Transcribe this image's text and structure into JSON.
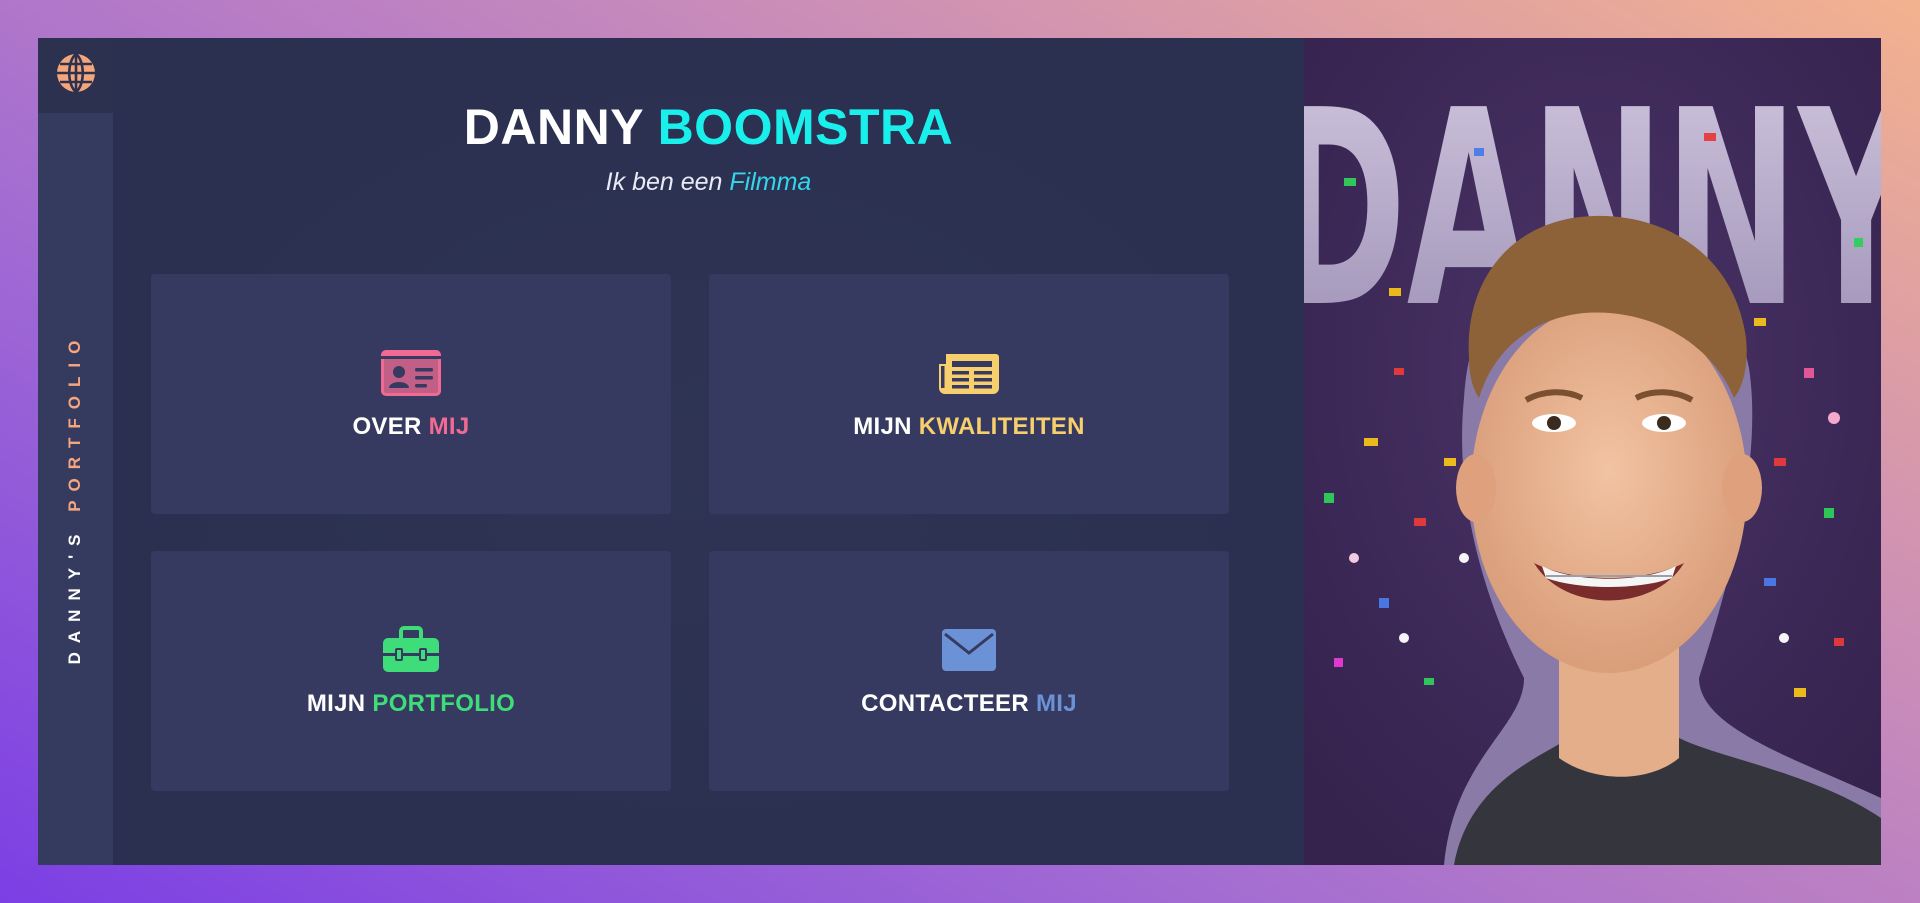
{
  "sidebar": {
    "globe_icon": "globe-icon",
    "vertical_label_main": "DANNY'S",
    "vertical_label_accent": "PORTFOLIO"
  },
  "header": {
    "title_first": "DANNY",
    "title_last": "BOOMSTRA",
    "subtitle_prefix": "Ik ben een",
    "subtitle_accent": "Filmma"
  },
  "cards": [
    {
      "icon": "id-card-icon",
      "label_main": "OVER",
      "label_accent": "MIJ",
      "accent_color": "#f06b94"
    },
    {
      "icon": "newspaper-icon",
      "label_main": "MIJN",
      "label_accent": "KWALITEITEN",
      "accent_color": "#f7cf6c"
    },
    {
      "icon": "toolbox-icon",
      "label_main": "MIJN",
      "label_accent": "PORTFOLIO",
      "accent_color": "#3fdc7a"
    },
    {
      "icon": "envelope-icon",
      "label_main": "CONTACTEER",
      "label_accent": "MIJ",
      "accent_color": "#6b92d6"
    }
  ],
  "photo": {
    "backdrop_text": "DANNY"
  },
  "colors": {
    "page_gradient_start": "#7b3fe4",
    "page_gradient_end": "#f3b28e",
    "panel_bg": "#2c3150",
    "card_bg": "#373a60",
    "title_accent": "#19f0ec",
    "sidebar_accent": "#f6a57f"
  }
}
